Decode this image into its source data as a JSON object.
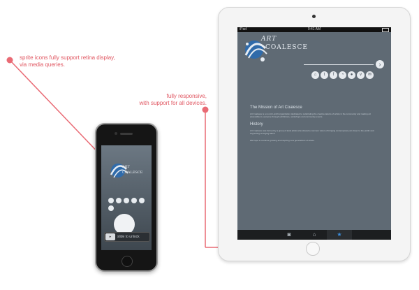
{
  "annotations": {
    "retina": "sprite icons fully support retina display,\nvia media queries.",
    "responsive": "fully responsive,\nwith support for all devices."
  },
  "ipad": {
    "status": {
      "carrier": "iPad",
      "time": "9:41 AM"
    },
    "logo": {
      "line1": "ART",
      "line2": "COALESCE"
    },
    "next_arrow": "›",
    "social_icons": [
      "home-icon",
      "twitter-icon",
      "facebook-icon",
      "rss-icon",
      "flickr-icon",
      "vimeo-icon",
      "mail-icon"
    ],
    "content": {
      "heading1": "The Mission of Art Coalesce",
      "para1": "Art Coalesce is a non-for-profit organization dedicated to celebrating the creative talents of artists in the community and making art accessible to everyone through exhibitions, workshops and community events.",
      "heading2": "History",
      "para2": "Art Coalesce was formed by a group of local artists who shared a common vision of bringing contemporary art closer to the public and supporting emerging talent.",
      "para3": "We hope to continue growing and inspiring new generations of artists."
    },
    "tabs": [
      {
        "name": "camera-icon",
        "glyph": "◙"
      },
      {
        "name": "home-icon",
        "glyph": "⌂"
      },
      {
        "name": "star-icon",
        "glyph": "★"
      }
    ],
    "colors": {
      "screen": "#5f6a74",
      "tab_active": "#3b8fe0"
    }
  },
  "iphone": {
    "logo": {
      "line1": "ART",
      "line2": "COALESCE"
    },
    "unlock_label": "slide to unlock",
    "unlock_knob": "▸"
  }
}
